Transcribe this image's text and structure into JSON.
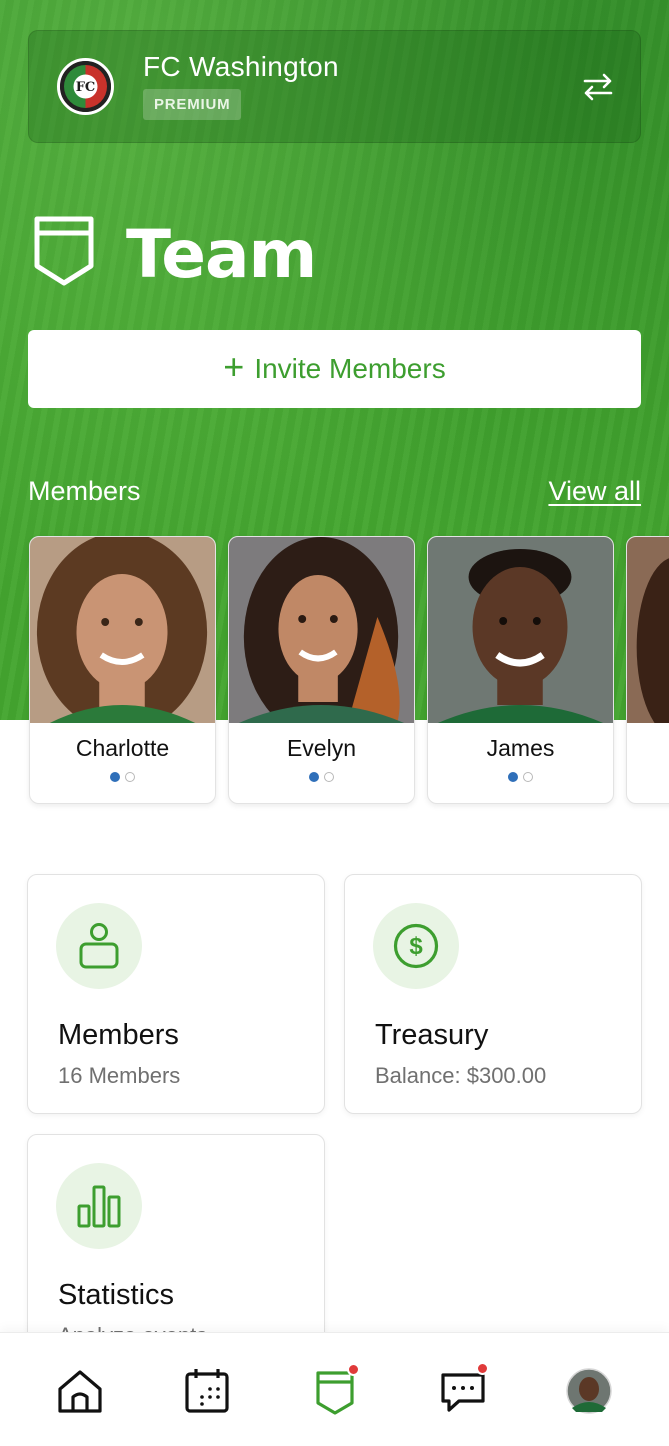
{
  "club": {
    "name": "FC Washington",
    "tier": "PREMIUM",
    "logo_text": "FC"
  },
  "page": {
    "title": "Team"
  },
  "invite": {
    "label": "Invite Members"
  },
  "members_section": {
    "heading": "Members",
    "view_all": "View all",
    "members": [
      {
        "name": "Charlotte"
      },
      {
        "name": "Evelyn"
      },
      {
        "name": "James"
      }
    ]
  },
  "tiles": {
    "members": {
      "title": "Members",
      "subtitle": "16 Members"
    },
    "treasury": {
      "title": "Treasury",
      "subtitle": "Balance: $300.00"
    },
    "statistics": {
      "title": "Statistics",
      "subtitle": "Analyze events"
    }
  },
  "nav": {
    "items": [
      "home-icon",
      "calendar-icon",
      "team-icon",
      "chat-icon",
      "profile-avatar"
    ],
    "active": "team-icon"
  },
  "colors": {
    "brand_green": "#3d9e2f",
    "badge_red": "#e03a3a",
    "dot_blue": "#2f6fb9"
  }
}
